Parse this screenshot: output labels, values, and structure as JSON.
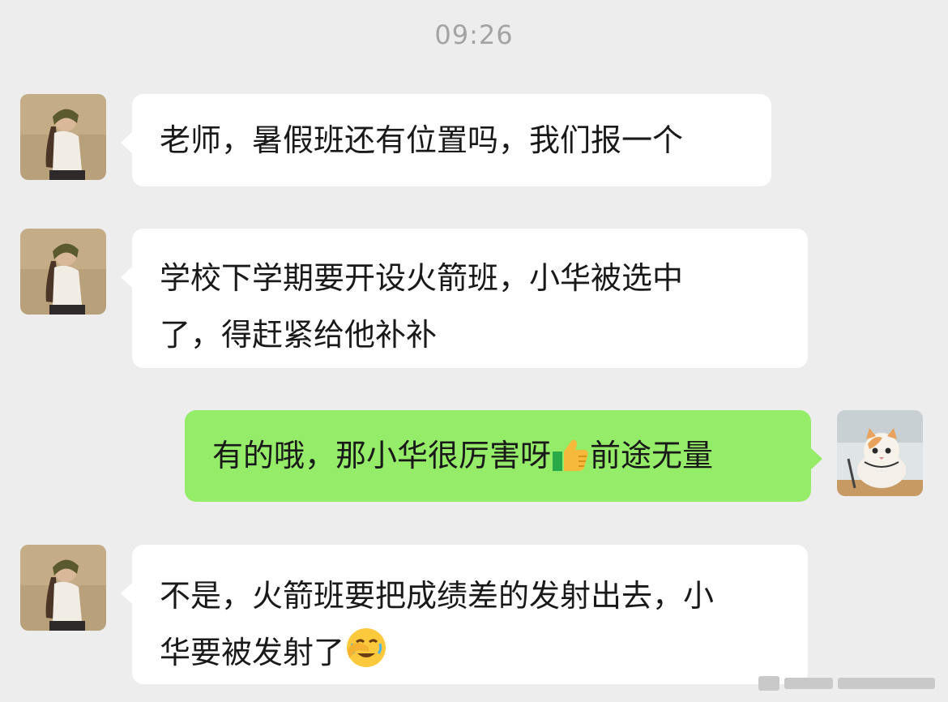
{
  "chat": {
    "timestamp": "09:26",
    "messages": [
      {
        "sender": "contact",
        "text": "老师，暑假班还有位置吗，我们报一个"
      },
      {
        "sender": "contact",
        "line1": "学校下学期要开设火箭班，小华被选中",
        "line2": "了，得赶紧给他补补"
      },
      {
        "sender": "self",
        "text_before": "有的哦，那小华很厉害呀",
        "emoji": "thumbs-up-icon",
        "text_after": "前途无量"
      },
      {
        "sender": "contact",
        "line1": "不是，火箭班要把成绩差的发射出去，小",
        "line2": "华要被发射了",
        "emoji": "face-palm-icon"
      }
    ]
  },
  "colors": {
    "background": "#ededed",
    "incoming_bubble": "#ffffff",
    "outgoing_bubble": "#95ec69",
    "timestamp_text": "#a3a3a3"
  }
}
